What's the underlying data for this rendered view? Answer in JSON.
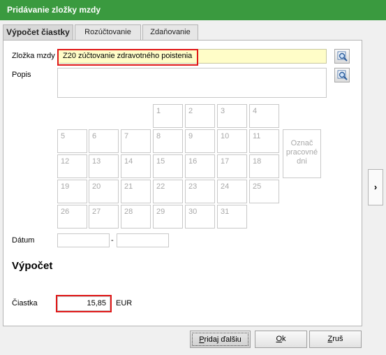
{
  "window": {
    "title": "Pridávanie zložky mzdy"
  },
  "tabs": [
    {
      "label": "Výpočet čiastky",
      "active": true
    },
    {
      "label": "Rozúčtovanie",
      "active": false
    },
    {
      "label": "Zdaňovanie",
      "active": false
    }
  ],
  "form": {
    "zlozka_label": "Zložka mzdy",
    "zlozka_value": "Z20  zúčtovanie zdravotného poistenia",
    "popis_label": "Popis",
    "popis_value": "",
    "datum_label": "Dátum",
    "datum_from": "",
    "datum_separator": "-",
    "datum_to": "",
    "section_heading": "Výpočet",
    "ciastka_label": "Čiastka",
    "ciastka_value": "15,85",
    "currency": "EUR"
  },
  "calendar": {
    "days": [
      "1",
      "2",
      "3",
      "4",
      "5",
      "6",
      "7",
      "8",
      "9",
      "10",
      "11",
      "12",
      "13",
      "14",
      "15",
      "16",
      "17",
      "18",
      "19",
      "20",
      "21",
      "22",
      "23",
      "24",
      "25",
      "26",
      "27",
      "28",
      "29",
      "30",
      "31"
    ],
    "mark_button": [
      "Označ",
      "pracovné",
      "dni"
    ]
  },
  "buttons": {
    "add_next": {
      "prefix": "",
      "mnemonic": "P",
      "rest": "ridaj ďalšiu"
    },
    "ok": {
      "mnemonic": "O",
      "rest": "k"
    },
    "cancel": {
      "mnemonic": "Z",
      "rest": "ruš"
    }
  },
  "side_arrow": "›",
  "colors": {
    "title_bar": "#3a9a3f",
    "highlight_border": "#e01818",
    "zlozka_field_bg": "#fffdc8"
  },
  "icons": {
    "lookup": "magnifier-icon",
    "side": "chevron-right-icon"
  }
}
